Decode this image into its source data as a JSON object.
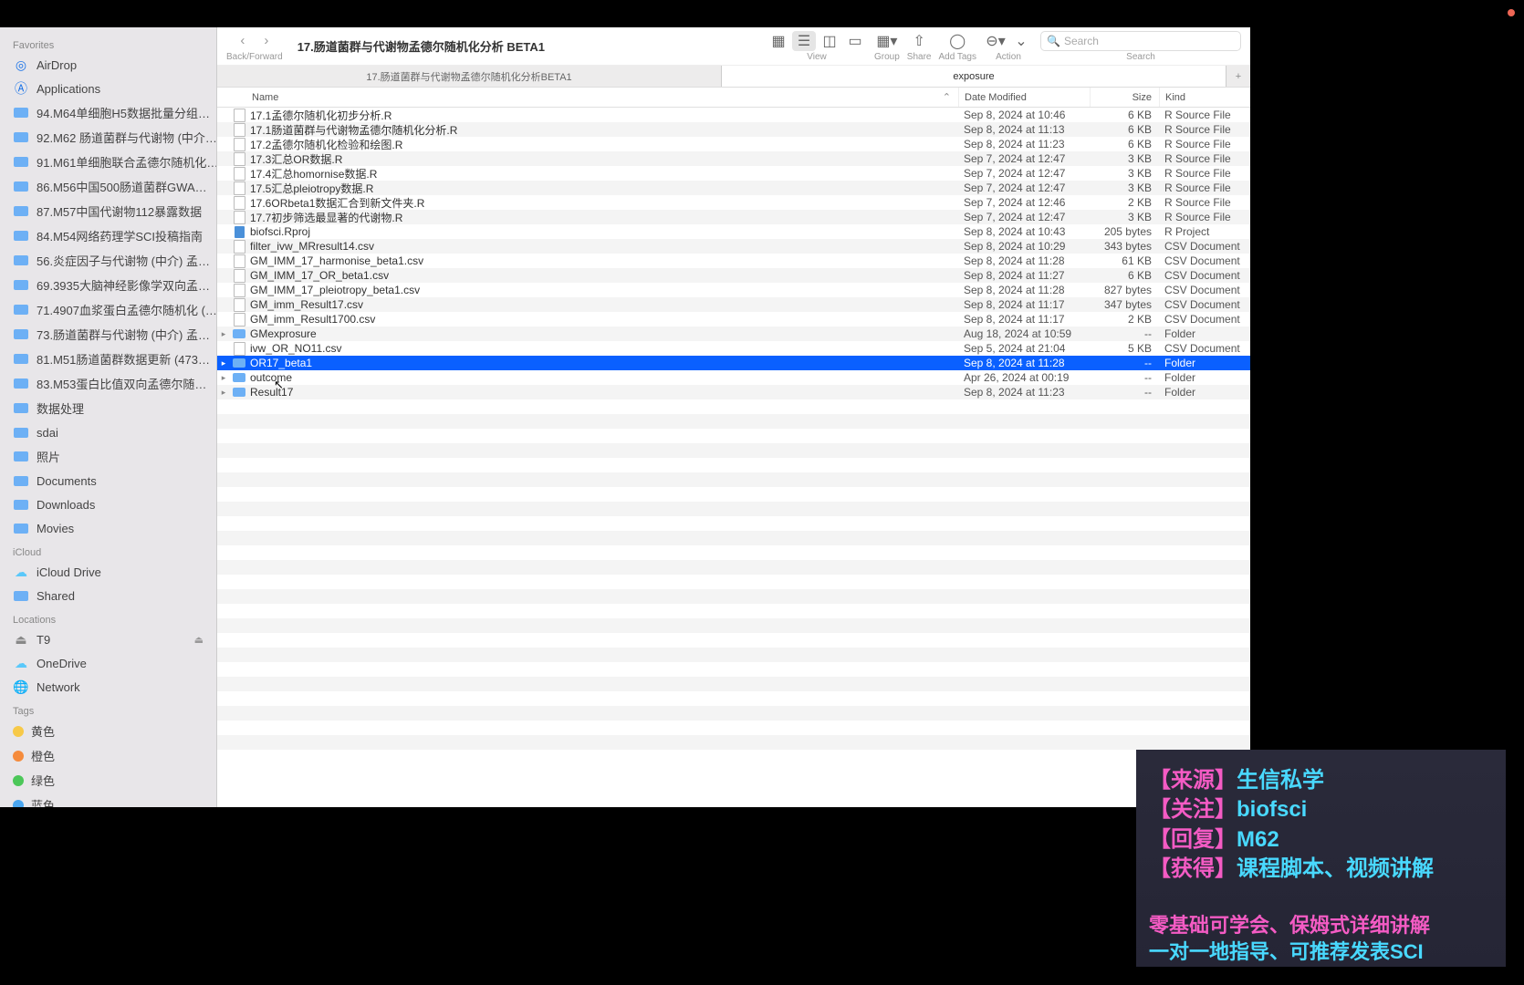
{
  "window": {
    "title": "17.肠道菌群与代谢物孟德尔随机化分析 BETA1",
    "back_forward_label": "Back/Forward"
  },
  "toolbar": {
    "view_label": "View",
    "group_label": "Group",
    "share_label": "Share",
    "addtags_label": "Add Tags",
    "action_label": "Action",
    "search_label": "Search",
    "search_placeholder": "Search"
  },
  "path_tabs": {
    "left": "17.肠道菌群与代谢物孟德尔随机化分析BETA1",
    "right": "exposure",
    "add": "+"
  },
  "columns": {
    "name": "Name",
    "date": "Date Modified",
    "size": "Size",
    "kind": "Kind",
    "sort_arrow": "⌃"
  },
  "sidebar": {
    "favorites": "Favorites",
    "icloud": "iCloud",
    "locations": "Locations",
    "tags": "Tags",
    "items": [
      {
        "icon": "airdrop",
        "label": "AirDrop"
      },
      {
        "icon": "apps",
        "label": "Applications"
      },
      {
        "icon": "folder",
        "label": "94.M64单细胞H5数据批量分组…"
      },
      {
        "icon": "folder",
        "label": "92.M62 肠道菌群与代谢物 (中介…"
      },
      {
        "icon": "folder",
        "label": "91.M61单细胞联合孟德尔随机化…"
      },
      {
        "icon": "folder",
        "label": "86.M56中国500肠道菌群GWA…"
      },
      {
        "icon": "folder",
        "label": "87.M57中国代谢物112暴露数据"
      },
      {
        "icon": "folder",
        "label": "84.M54网络药理学SCI投稿指南"
      },
      {
        "icon": "folder",
        "label": "56.炎症因子与代谢物 (中介) 孟…"
      },
      {
        "icon": "folder",
        "label": "69.3935大脑神经影像学双向孟…"
      },
      {
        "icon": "folder",
        "label": "71.4907血浆蛋白孟德尔随机化 (…"
      },
      {
        "icon": "folder",
        "label": "73.肠道菌群与代谢物 (中介) 孟…"
      },
      {
        "icon": "folder",
        "label": "81.M51肠道菌群数据更新 (473…"
      },
      {
        "icon": "folder",
        "label": "83.M53蛋白比值双向孟德尔随…"
      },
      {
        "icon": "folder",
        "label": "数据处理"
      },
      {
        "icon": "folder",
        "label": "sdai"
      },
      {
        "icon": "folder",
        "label": "照片"
      },
      {
        "icon": "folder",
        "label": "Documents"
      },
      {
        "icon": "folder",
        "label": "Downloads"
      },
      {
        "icon": "folder",
        "label": "Movies"
      }
    ],
    "icloud_items": [
      {
        "icon": "cloud",
        "label": "iCloud Drive"
      },
      {
        "icon": "folder",
        "label": "Shared"
      }
    ],
    "loc_items": [
      {
        "icon": "drive",
        "label": "T9",
        "eject": "⏏"
      },
      {
        "icon": "cloud",
        "label": "OneDrive"
      },
      {
        "icon": "net",
        "label": "Network"
      }
    ],
    "tag_items": [
      {
        "color": "#f7c948",
        "label": "黄色"
      },
      {
        "color": "#f58b3c",
        "label": "橙色"
      },
      {
        "color": "#4cc759",
        "label": "绿色"
      },
      {
        "color": "#4aa6f0",
        "label": "蓝色"
      }
    ]
  },
  "files": [
    {
      "t": "doc",
      "name": "17.1孟德尔随机化初步分析.R",
      "date": "Sep 8, 2024 at 10:46",
      "size": "6 KB",
      "kind": "R Source File"
    },
    {
      "t": "doc",
      "name": "17.1肠道菌群与代谢物孟德尔随机化分析.R",
      "date": "Sep 8, 2024 at 11:13",
      "size": "6 KB",
      "kind": "R Source File"
    },
    {
      "t": "doc",
      "name": "17.2孟德尔随机化检验和绘图.R",
      "date": "Sep 8, 2024 at 11:23",
      "size": "6 KB",
      "kind": "R Source File"
    },
    {
      "t": "doc",
      "name": "17.3汇总OR数据.R",
      "date": "Sep 7, 2024 at 12:47",
      "size": "3 KB",
      "kind": "R Source File"
    },
    {
      "t": "doc",
      "name": "17.4汇总homornise数据.R",
      "date": "Sep 7, 2024 at 12:47",
      "size": "3 KB",
      "kind": "R Source File"
    },
    {
      "t": "doc",
      "name": "17.5汇总pleiotropy数据.R",
      "date": "Sep 7, 2024 at 12:47",
      "size": "3 KB",
      "kind": "R Source File"
    },
    {
      "t": "doc",
      "name": "17.6ORbeta1数据汇合到新文件夹.R",
      "date": "Sep 7, 2024 at 12:46",
      "size": "2 KB",
      "kind": "R Source File"
    },
    {
      "t": "doc",
      "name": "17.7初步筛选最显著的代谢物.R",
      "date": "Sep 7, 2024 at 12:47",
      "size": "3 KB",
      "kind": "R Source File"
    },
    {
      "t": "rproj",
      "name": "biofsci.Rproj",
      "date": "Sep 8, 2024 at 10:43",
      "size": "205 bytes",
      "kind": "R Project"
    },
    {
      "t": "doc",
      "name": "filter_ivw_MRresult14.csv",
      "date": "Sep 8, 2024 at 10:29",
      "size": "343 bytes",
      "kind": "CSV Document"
    },
    {
      "t": "doc",
      "name": "GM_IMM_17_harmonise_beta1.csv",
      "date": "Sep 8, 2024 at 11:28",
      "size": "61 KB",
      "kind": "CSV Document"
    },
    {
      "t": "doc",
      "name": "GM_IMM_17_OR_beta1.csv",
      "date": "Sep 8, 2024 at 11:27",
      "size": "6 KB",
      "kind": "CSV Document"
    },
    {
      "t": "doc",
      "name": "GM_IMM_17_pleiotropy_beta1.csv",
      "date": "Sep 8, 2024 at 11:28",
      "size": "827 bytes",
      "kind": "CSV Document"
    },
    {
      "t": "doc",
      "name": "GM_imm_Result17.csv",
      "date": "Sep 8, 2024 at 11:17",
      "size": "347 bytes",
      "kind": "CSV Document"
    },
    {
      "t": "doc",
      "name": "GM_imm_Result1700.csv",
      "date": "Sep 8, 2024 at 11:17",
      "size": "2 KB",
      "kind": "CSV Document"
    },
    {
      "t": "fold",
      "name": "GMexprosure",
      "date": "Aug 18, 2024 at 10:59",
      "size": "--",
      "kind": "Folder",
      "d": true
    },
    {
      "t": "doc",
      "name": "ivw_OR_NO11.csv",
      "date": "Sep 5, 2024 at 21:04",
      "size": "5 KB",
      "kind": "CSV Document"
    },
    {
      "t": "fold",
      "name": "OR17_beta1",
      "date": "Sep 8, 2024 at 11:28",
      "size": "--",
      "kind": "Folder",
      "d": true,
      "sel": true
    },
    {
      "t": "fold",
      "name": "outcome",
      "date": "Apr 26, 2024 at 00:19",
      "size": "--",
      "kind": "Folder",
      "d": true
    },
    {
      "t": "fold",
      "name": "Result17",
      "date": "Sep 8, 2024 at 11:23",
      "size": "--",
      "kind": "Folder",
      "d": true
    }
  ],
  "overlay": {
    "l1a": "【来源】",
    "l1b": "生信私学",
    "l2a": "【关注】",
    "l2b": "biofsci",
    "l3a": "【回复】",
    "l3b": "M62",
    "l4a": "【获得】",
    "l4b": "课程脚本、视频讲解",
    "l5": "零基础可学会、保姆式详细讲解",
    "l6": "一对一地指导、可推荐发表SCI"
  }
}
